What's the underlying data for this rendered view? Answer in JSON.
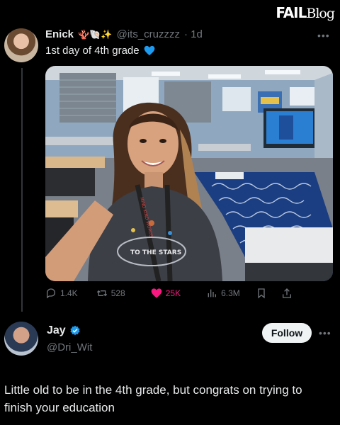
{
  "watermark": {
    "fail": "FAIL",
    "blog": "Blog"
  },
  "post": {
    "author_name": "Enick",
    "author_emojis": "🪸🐚✨",
    "author_handle": "@its_cruzzzz",
    "time": "· 1d",
    "text": "1st day of 4th grade",
    "lanyard_text": "MIND KIND WORDS",
    "shirt_text": "TO THE STARS"
  },
  "actions": {
    "replies": "1.4K",
    "reposts": "528",
    "likes": "25K",
    "views": "6.3M"
  },
  "reply": {
    "name": "Jay",
    "handle": "@Dri_Wit",
    "follow_label": "Follow",
    "text": "Little old to be in the 4th grade, but congrats on trying to finish your education"
  },
  "colors": {
    "accent": "#1d9bf0",
    "like": "#f91880",
    "muted": "#71767b"
  }
}
